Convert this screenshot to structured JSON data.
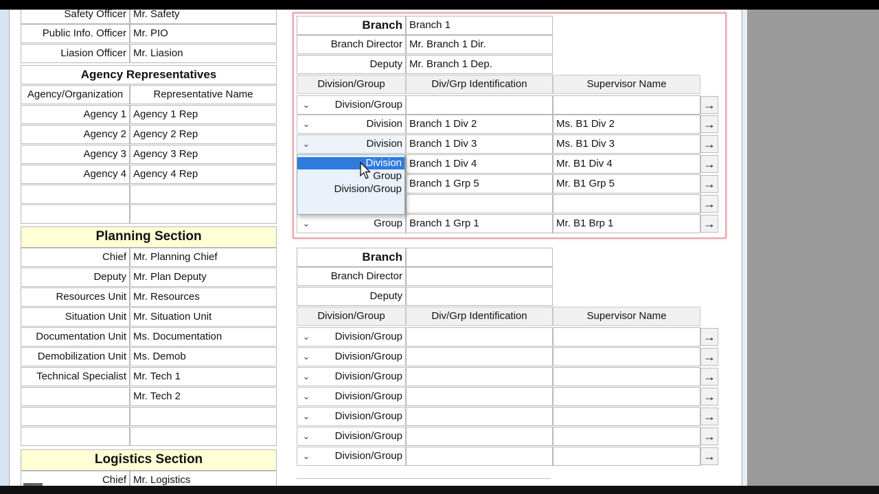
{
  "command": {
    "rows": [
      {
        "label": "Safety Officer",
        "value": "Mr. Safety"
      },
      {
        "label": "Public Info. Officer",
        "value": "Mr. PIO"
      },
      {
        "label": "Liasion Officer",
        "value": "Mr. Liasion"
      }
    ],
    "agency_title": "Agency Representatives",
    "agency_headers": [
      "Agency/Organization",
      "Representative Name"
    ],
    "agencies": [
      {
        "agency": "Agency 1",
        "rep": "Agency 1 Rep"
      },
      {
        "agency": "Agency 2",
        "rep": "Agency 2 Rep"
      },
      {
        "agency": "Agency 3",
        "rep": "Agency 3 Rep"
      },
      {
        "agency": "Agency 4",
        "rep": "Agency 4 Rep"
      }
    ]
  },
  "planning": {
    "title": "Planning Section",
    "rows": [
      {
        "label": "Chief",
        "value": "Mr. Planning Chief"
      },
      {
        "label": "Deputy",
        "value": "Mr. Plan Deputy"
      },
      {
        "label": "Resources Unit",
        "value": "Mr. Resources"
      },
      {
        "label": "Situation Unit",
        "value": "Mr. Situation Unit"
      },
      {
        "label": "Documentation Unit",
        "value": "Ms. Documentation"
      },
      {
        "label": "Demobilization Unit",
        "value": "Ms. Demob"
      },
      {
        "label": "Technical Specialist",
        "value": "Mr. Tech 1"
      },
      {
        "label": "",
        "value": "Mr. Tech 2"
      }
    ]
  },
  "logistics": {
    "title": "Logistics Section",
    "rows": [
      {
        "label": "Chief",
        "value": "Mr. Logistics"
      }
    ]
  },
  "branch1": {
    "branch_label": "Branch",
    "branch_value": "Branch 1",
    "director_label": "Branch Director",
    "director_value": "Mr. Branch 1 Dir.",
    "deputy_label": "Deputy",
    "deputy_value": "Mr. Branch 1 Dep.",
    "headers": [
      "Division/Group",
      "Div/Grp Identification",
      "Supervisor Name"
    ],
    "rows": [
      {
        "type": "Division/Group",
        "id": "",
        "sup": ""
      },
      {
        "type": "Division",
        "id": "Branch 1 Div 2",
        "sup": "Ms. B1 Div 2"
      },
      {
        "type": "Division",
        "id": "Branch 1 Div 3",
        "sup": "Ms. B1 Div 3"
      },
      {
        "type": "",
        "id": "Branch 1 Div 4",
        "sup": "Mr. B1 Div 4"
      },
      {
        "type": "",
        "id": "Branch 1 Grp 5",
        "sup": "Mr. B1 Grp 5"
      },
      {
        "type": "",
        "id": "",
        "sup": ""
      },
      {
        "type": "Group",
        "id": "Branch 1 Grp 1",
        "sup": "Mr. B1 Brp 1"
      }
    ],
    "dropdown_options": [
      "Division",
      "Group",
      "Division/Group"
    ],
    "dropdown_selected": "Division"
  },
  "branch2": {
    "branch_label": "Branch",
    "branch_value": "",
    "director_label": "Branch Director",
    "director_value": "",
    "deputy_label": "Deputy",
    "deputy_value": "",
    "headers": [
      "Division/Group",
      "Div/Grp Identification",
      "Supervisor Name"
    ],
    "rows": [
      {
        "type": "Division/Group"
      },
      {
        "type": "Division/Group"
      },
      {
        "type": "Division/Group"
      },
      {
        "type": "Division/Group"
      },
      {
        "type": "Division/Group"
      },
      {
        "type": "Division/Group"
      },
      {
        "type": "Division/Group"
      }
    ]
  },
  "icons": {
    "chevron": "chevron-down-icon",
    "arrow": "arrow-right-icon",
    "cursor": "mouse-pointer-icon"
  },
  "colors": {
    "section_bg": "#ffffd6",
    "highlight_border": "#e8a7ad",
    "selection": "#2f7bde"
  }
}
